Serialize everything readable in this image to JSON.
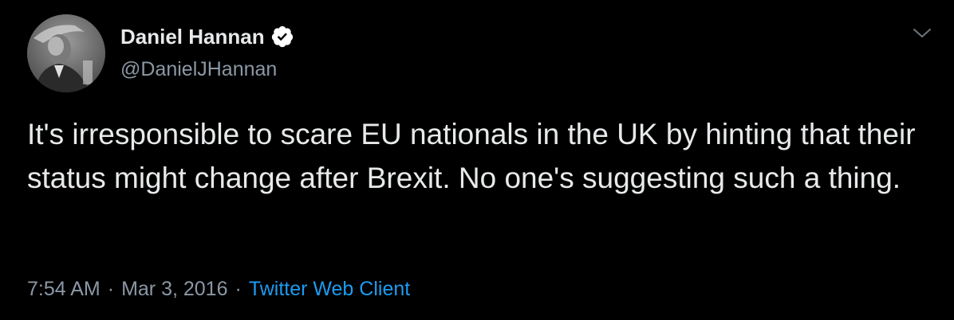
{
  "tweet": {
    "author": {
      "display_name": "Daniel Hannan",
      "handle": "@DanielJHannan",
      "verified": true,
      "avatar_icon": "profile-photo"
    },
    "text": "It's irresponsible to scare EU nationals in the UK by hinting that their status might change after Brexit. No one's suggesting such a thing.",
    "time": "7:54 AM",
    "separator": "·",
    "date": "Mar 3, 2016",
    "source": "Twitter Web Client",
    "menu_icon": "chevron-down-icon"
  },
  "colors": {
    "background": "#000000",
    "primary_text": "#e7e9ea",
    "secondary_text": "#8b98a5",
    "link": "#1d9bf0",
    "verified_badge": "#ffffff"
  }
}
